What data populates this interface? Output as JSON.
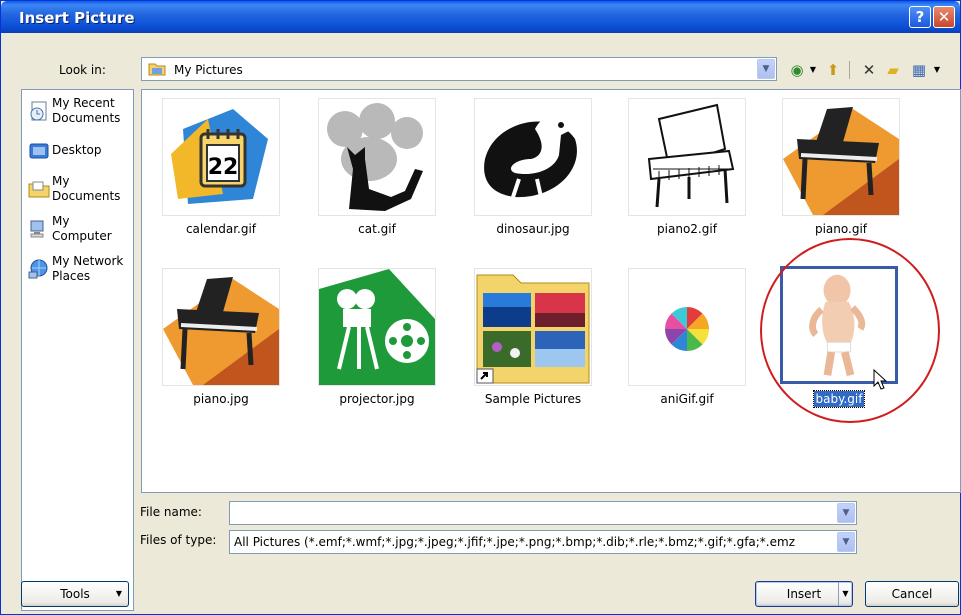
{
  "window": {
    "title": "Insert Picture",
    "help_glyph": "?",
    "close_glyph": "✕"
  },
  "lookin": {
    "label": "Look in:",
    "value": "My Pictures",
    "arrow": "▼"
  },
  "toolbar": [
    {
      "name": "back-icon",
      "glyph": "◉"
    },
    {
      "name": "dropdown-icon",
      "glyph": "▼"
    },
    {
      "name": "up-folder-icon",
      "glyph": "⬆"
    },
    {
      "name": "delete-icon",
      "glyph": "✕"
    },
    {
      "name": "new-folder-icon",
      "glyph": "▰"
    },
    {
      "name": "views-icon",
      "glyph": "▦"
    },
    {
      "name": "views-dropdown-icon",
      "glyph": "▼"
    }
  ],
  "places": [
    {
      "label": "My Recent Documents",
      "icon": "recent-documents-icon"
    },
    {
      "label": "Desktop",
      "icon": "desktop-icon"
    },
    {
      "label": "My Documents",
      "icon": "my-documents-icon"
    },
    {
      "label": "My Computer",
      "icon": "my-computer-icon"
    },
    {
      "label": "My Network Places",
      "icon": "network-places-icon"
    }
  ],
  "files": [
    {
      "name": "calendar.gif"
    },
    {
      "name": "cat.gif"
    },
    {
      "name": "dinosaur.jpg"
    },
    {
      "name": "piano2.gif"
    },
    {
      "name": "piano.gif"
    },
    {
      "name": "piano.jpg"
    },
    {
      "name": "projector.jpg"
    },
    {
      "name": "Sample Pictures"
    },
    {
      "name": "aniGif.gif"
    },
    {
      "name": "baby.gif",
      "selected": true
    }
  ],
  "filename": {
    "label": "File name:",
    "value": ""
  },
  "filetype": {
    "label": "Files of type:",
    "value": "All Pictures (*.emf;*.wmf;*.jpg;*.jpeg;*.jfif;*.jpe;*.png;*.bmp;*.dib;*.rle;*.bmz;*.gif;*.gfa;*.emz"
  },
  "buttons": {
    "tools": "Tools",
    "insert": "Insert",
    "cancel": "Cancel",
    "arrow": "▼"
  },
  "colors": {
    "titlebar": "#0a5ae8",
    "selection": "#316ac5",
    "highlight_circle": "#d01c1c"
  }
}
